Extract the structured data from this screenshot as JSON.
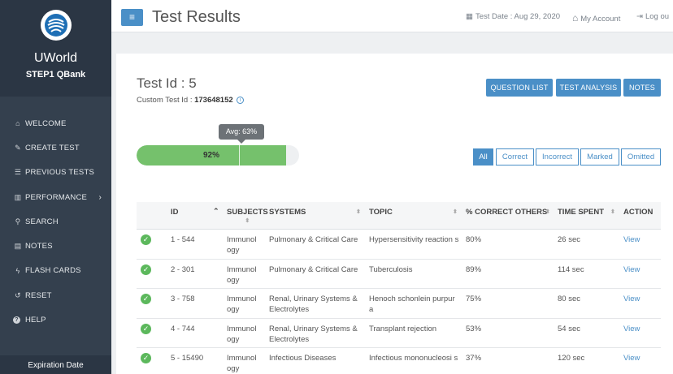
{
  "sidebar": {
    "brand_name": "UWorld",
    "brand_sub": "STEP1 QBank",
    "items": [
      {
        "icon": "home-icon",
        "glyph": "⌂",
        "label": "WELCOME"
      },
      {
        "icon": "edit-icon",
        "glyph": "✎",
        "label": "CREATE TEST"
      },
      {
        "icon": "list-icon",
        "glyph": "☰",
        "label": "PREVIOUS TESTS"
      },
      {
        "icon": "bar-chart-icon",
        "glyph": "▥",
        "label": "PERFORMANCE"
      },
      {
        "icon": "search-icon",
        "glyph": "⚲",
        "label": "SEARCH"
      },
      {
        "icon": "notes-icon",
        "glyph": "▤",
        "label": "NOTES"
      },
      {
        "icon": "bolt-icon",
        "glyph": "ϟ",
        "label": "FLASH CARDS"
      },
      {
        "icon": "reset-icon",
        "glyph": "↺",
        "label": "RESET"
      },
      {
        "icon": "help-icon",
        "glyph": "?",
        "label": "HELP"
      }
    ],
    "expiry_label": "Expiration Date"
  },
  "header": {
    "title": "Test Results",
    "test_date": "Test Date : Aug 29, 2020",
    "my_account": "My Account",
    "logout": "Log ou"
  },
  "test": {
    "id_label": "Test Id : 5",
    "custom_id_prefix": "Custom Test Id : ",
    "custom_id_value": "173648152",
    "buttons": {
      "question_list": "QUESTION LIST",
      "test_analysis": "TEST ANALYSIS",
      "notes": "NOTES"
    },
    "score_label": "92%",
    "score_value": 92,
    "avg_label": "Avg: 63%",
    "avg_value": 63
  },
  "filters": {
    "all": "All",
    "correct": "Correct",
    "incorrect": "Incorrect",
    "marked": "Marked",
    "omitted": "Omitted"
  },
  "table": {
    "headers": {
      "id": "ID",
      "subjects": "SUBJECTS",
      "systems": "SYSTEMS",
      "topic": "TOPIC",
      "pct": "% CORRECT OTHERS",
      "time": "TIME SPENT",
      "action": "ACTION"
    },
    "rows": [
      {
        "id": "1 - 544",
        "subject": "Immunol ogy",
        "system": "Pulmonary & Critical Care",
        "topic": "Hypersensitivity reaction s",
        "pct": "80%",
        "time": "26 sec",
        "action": "View"
      },
      {
        "id": "2 - 301",
        "subject": "Immunol ogy",
        "system": "Pulmonary & Critical Care",
        "topic": "Tuberculosis",
        "pct": "89%",
        "time": "114 sec",
        "action": "View"
      },
      {
        "id": "3 - 758",
        "subject": "Immunol ogy",
        "system": "Renal, Urinary Systems & Electrolytes",
        "topic": "Henoch schonlein purpur a",
        "pct": "75%",
        "time": "80 sec",
        "action": "View"
      },
      {
        "id": "4 - 744",
        "subject": "Immunol ogy",
        "system": "Renal, Urinary Systems & Electrolytes",
        "topic": "Transplant rejection",
        "pct": "53%",
        "time": "54 sec",
        "action": "View"
      },
      {
        "id": "5 - 15490",
        "subject": "Immunol ogy",
        "system": "Infectious Diseases",
        "topic": "Infectious mononucleosi s",
        "pct": "37%",
        "time": "120 sec",
        "action": "View"
      }
    ]
  }
}
